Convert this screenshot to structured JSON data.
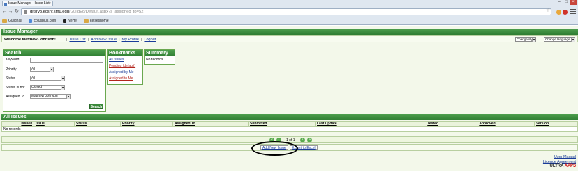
{
  "browser": {
    "tab_title": "Issue Manager - Issue List",
    "url_host": "gitsrv3.ecsrv.smu.edu",
    "url_path": "/GuildEd/Default.aspx?s_assigned_to=52",
    "bookmarks": [
      "Guildhall",
      "cplusplus.com",
      "NeHe",
      "kelseshome"
    ]
  },
  "app": {
    "header": "Issue Manager",
    "welcome": "Welcome Matthew Johnson!",
    "links": [
      "Issue List",
      "Add New Issue",
      "My Profile",
      "Logout"
    ],
    "change_style": "Change style",
    "change_language": "Change language"
  },
  "search": {
    "title": "Search",
    "keyword_label": "Keyword",
    "keyword_value": "",
    "priority_label": "Priority",
    "priority_value": "All",
    "status_label": "Status",
    "status_value": "All",
    "status_not_label": "Status is not",
    "status_not_value": "Closed",
    "assigned_label": "Assigned To",
    "assigned_value": "Matthew Johnson",
    "button": "Search"
  },
  "bookmarks_panel": {
    "title": "Bookmarks",
    "items": [
      "All Issues",
      "Pending (default)",
      "Assigned by Me",
      "Assigned to Me"
    ]
  },
  "summary": {
    "title": "Summary",
    "empty": "No records"
  },
  "issues": {
    "title": "All Issues",
    "columns": [
      "Issue#",
      "Issue",
      "Status",
      "Priority",
      "Assigned To",
      "Submitted",
      "Last Update",
      "Tested",
      "Approved",
      "Version"
    ],
    "empty": "No records",
    "pager": "1 of 1",
    "add_button": "Add New Issue",
    "export_button": "Export to Excel"
  },
  "footer": {
    "user_manual": "User Manual",
    "license": "Licence Agreement",
    "brand_a": "ULTRA",
    "brand_b": "APPS"
  }
}
